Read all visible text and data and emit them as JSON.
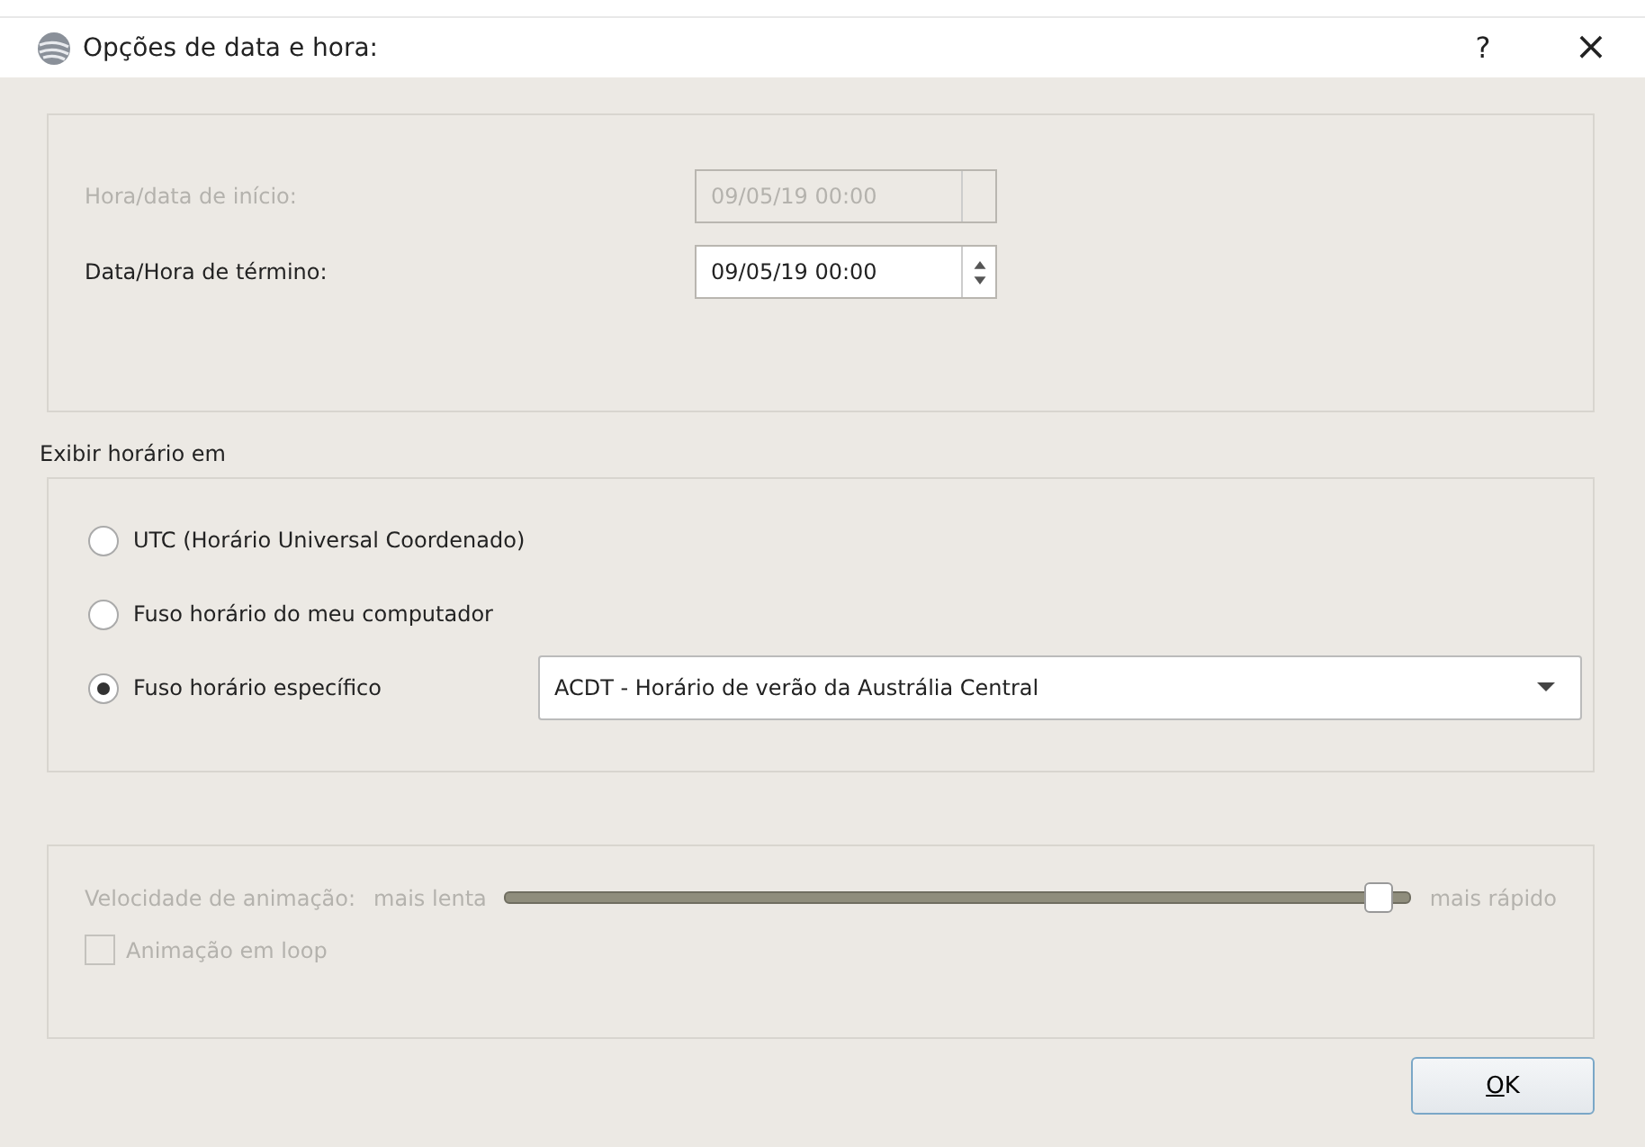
{
  "window": {
    "title": "Opções de data e hora:",
    "help": "?",
    "close": "×"
  },
  "time_range": [
    {
      "label": "Hora/data de início:",
      "value": "09/05/19 00:00",
      "disabled": true
    },
    {
      "label": "Data/Hora de término:",
      "value": "09/05/19 00:00",
      "disabled": false
    }
  ],
  "display": {
    "heading": "Exibir horário em",
    "options": [
      {
        "label": "UTC (Horário Universal Coordenado)",
        "selected": false
      },
      {
        "label": "Fuso horário do meu computador",
        "selected": false
      },
      {
        "label": "Fuso horário específico",
        "selected": true,
        "dropdown": "ACDT - Horário de verão da Austrália Central"
      }
    ]
  },
  "animation": {
    "disabled": true,
    "speed_label": "Velocidade de animação:",
    "slow": "mais lenta",
    "fast": "mais rápido",
    "level": 0.98,
    "loop": {
      "label": "Animação em loop",
      "checked": false
    }
  },
  "buttons": [
    "OK"
  ]
}
